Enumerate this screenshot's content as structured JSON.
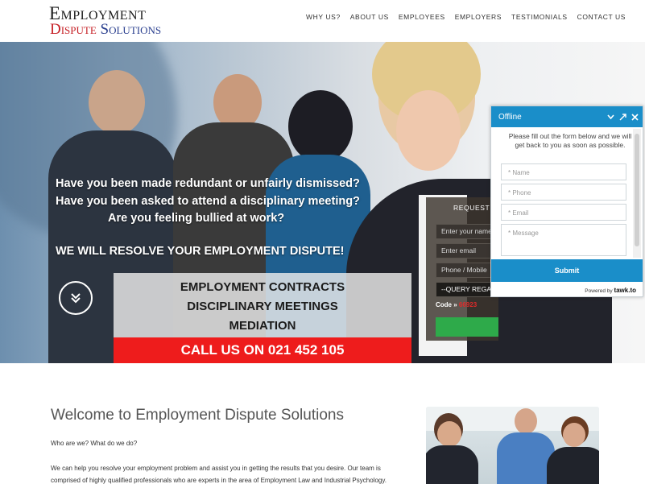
{
  "logo": {
    "line1": "Employment",
    "line2a": "Dispute",
    "line2b": "Solutions"
  },
  "nav": {
    "items": [
      "WHY US?",
      "ABOUT US",
      "EMPLOYEES",
      "EMPLOYERS",
      "TESTIMONIALS",
      "CONTACT US"
    ]
  },
  "hero": {
    "questions": [
      "Have you been made redundant or unfairly dismissed?",
      "Have you been asked to attend a disciplinary meeting?",
      "Are you feeling bullied at work?"
    ],
    "tagline": "WE WILL RESOLVE YOUR EMPLOYMENT DISPUTE!",
    "services": [
      "EMPLOYMENT CONTRACTS",
      "DISCIPLINARY MEETINGS",
      "MEDIATION"
    ],
    "call": "CALL US ON 021 452 105"
  },
  "request_form": {
    "title": "REQUEST A",
    "name_placeholder": "Enter your name",
    "email_placeholder": "Enter email",
    "phone_placeholder": "Phone / Mobile",
    "query_label": "--QUERY REGA",
    "code_label": "Code »",
    "code_value": "66923"
  },
  "chat": {
    "status": "Offline",
    "message": "Please fill out the form below and we will get back to you as soon as possible.",
    "name_placeholder": "* Name",
    "phone_placeholder": "* Phone",
    "email_placeholder": "* Email",
    "message_placeholder": "* Message",
    "submit": "Submit",
    "powered_by": "Powered by",
    "brand": "tawk.to"
  },
  "content": {
    "heading": "Welcome to Employment Dispute Solutions",
    "intro": "Who are we? What do we do?",
    "body": "We can help you resolve your employment problem and assist you in getting the results that you desire. Our team is comprised of highly qualified professionals who are experts in the area of Employment Law and Industrial Psychology."
  },
  "colors": {
    "accent_red": "#ee1c1c",
    "chat_blue": "#1a8ec9",
    "submit_green": "#2eaa4a"
  }
}
